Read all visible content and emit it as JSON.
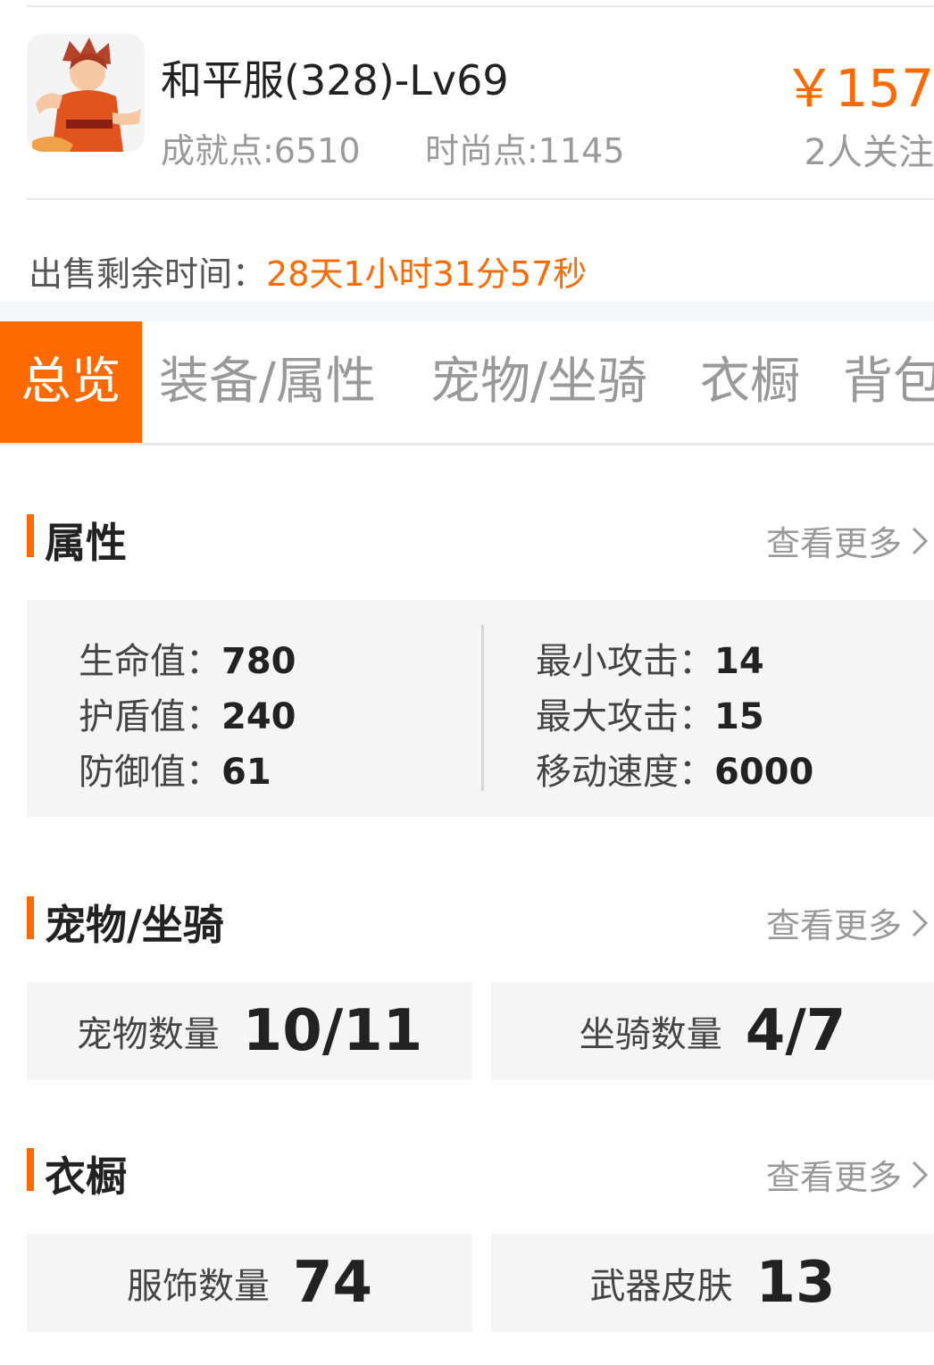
{
  "listing": {
    "title": "和平服(328)-Lv69",
    "achievement": "成就点:6510",
    "fashion": "时尚点:1145",
    "price": "￥157",
    "followers": "2人关注"
  },
  "timer": {
    "label": "出售剩余时间：",
    "value": "28天1小时31分57秒"
  },
  "tabs": [
    "总览",
    "装备/属性",
    "宠物/坐骑",
    "衣橱",
    "背包"
  ],
  "more_label": "查看更多",
  "attributes": {
    "title": "属性",
    "left": [
      {
        "label": "生命值：",
        "value": "780"
      },
      {
        "label": "护盾值：",
        "value": "240"
      },
      {
        "label": "防御值：",
        "value": "61"
      }
    ],
    "right": [
      {
        "label": "最小攻击：",
        "value": "14"
      },
      {
        "label": "最大攻击：",
        "value": "15"
      },
      {
        "label": "移动速度：",
        "value": "6000"
      }
    ]
  },
  "pets": {
    "title": "宠物/坐骑",
    "cards": [
      {
        "label": "宠物数量",
        "value": "10/11"
      },
      {
        "label": "坐骑数量",
        "value": "4/7"
      }
    ]
  },
  "wardrobe": {
    "title": "衣橱",
    "cards": [
      {
        "label": "服饰数量",
        "value": "74"
      },
      {
        "label": "武器皮肤",
        "value": "13"
      }
    ]
  },
  "colors": {
    "accent": "#ff6a00",
    "panel": "#f5f5f5",
    "muted": "#999999"
  }
}
